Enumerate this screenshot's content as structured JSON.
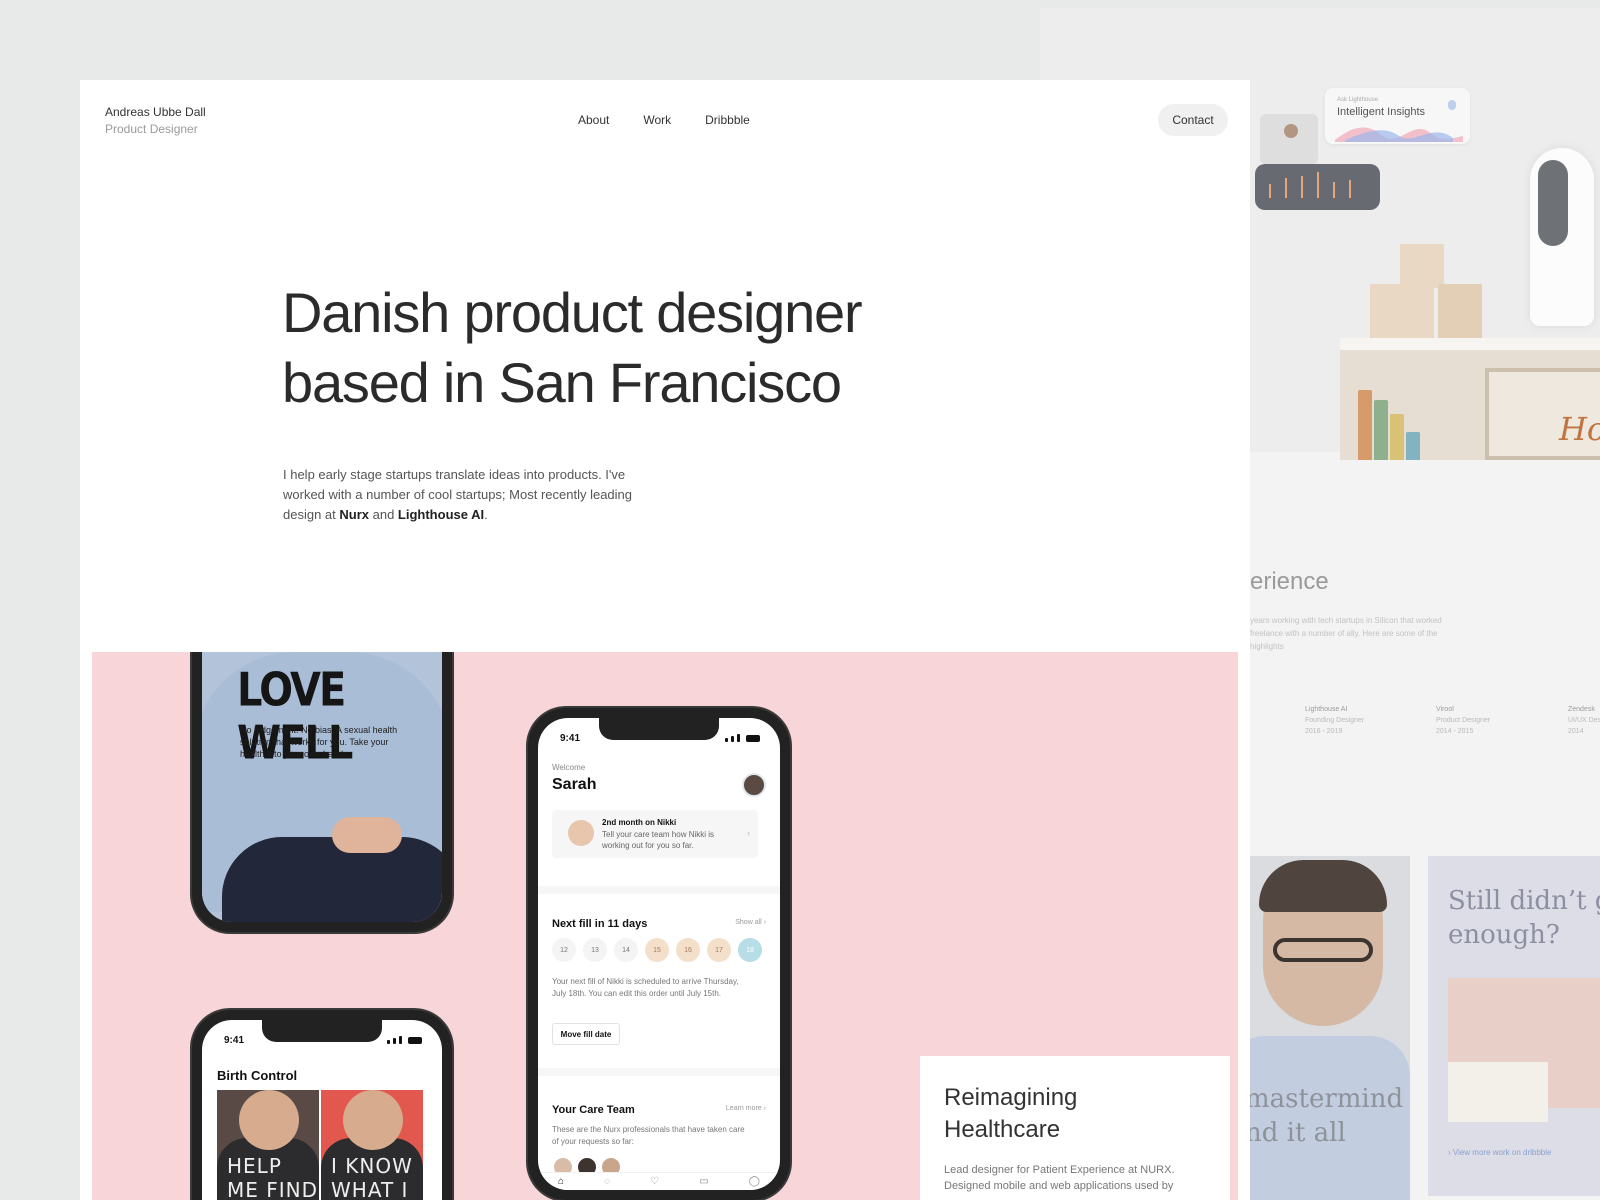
{
  "header": {
    "name": "Andreas Ubbe Dall",
    "role": "Product Designer",
    "nav": [
      "About",
      "Work",
      "Dribbble"
    ],
    "contact_label": "Contact"
  },
  "hero": {
    "title_line1": "Danish product designer",
    "title_line2": "based in San Francisco",
    "text_pre": "I help early stage startups translate ideas into products. I've worked with a number of cool startups; Most recently leading design at ",
    "brand1": "Nurx",
    "and": " and ",
    "brand2": "Lighthouse AI",
    "period": "."
  },
  "case": {
    "phone1": {
      "headline": "LOVE WELL",
      "subtext": "No judgement. No bias. A sexual health solution that works for you. Take your health into your own hands."
    },
    "phone2": {
      "time": "9:41",
      "title": "Birth Control",
      "image1_text": "HELP ME FIND",
      "image2_text": "I KNOW WHAT I"
    },
    "phone3": {
      "time": "9:41",
      "welcome": "Welcome",
      "user": "Sarah",
      "card_title": "2nd month on Nikki",
      "card_text": "Tell your care team how Nikki is working out for you so far.",
      "fill_title": "Next fill in 11 days",
      "show_all": "Show all",
      "days": [
        "12",
        "13",
        "14",
        "15",
        "16",
        "17",
        "18"
      ],
      "fill_text": "Your next fill of Nikki is scheduled to arrive Thursday, July 18th. You can edit this order until July 15th.",
      "move_button": "Move fill date",
      "care_title": "Your Care Team",
      "learn_more": "Learn more",
      "care_text": "These are the Nurx professionals that have taken care of your requests so far:",
      "tabs": [
        "home-icon",
        "chat-icon",
        "heart-icon",
        "calendar-icon",
        "profile-icon"
      ]
    },
    "card": {
      "title": "Reimagining Healthcare",
      "text": "Lead designer for Patient Experience at NURX. Designed mobile and web applications used by"
    },
    "colors": {
      "pink_bg": "#f8d5d8",
      "peach_day": "#f4dfca",
      "active_day": "#b7dde6"
    }
  },
  "background_page": {
    "insights_small": "Ask Lighthouse",
    "insights_title": "Intelligent Insights",
    "frame_text": "Hor",
    "experience_title": "erience",
    "experience_text": "years working with tech startups in Silicon that worked freelance with a number of ally. Here are some of the highlights",
    "jobs": [
      {
        "company": "Lighthouse AI",
        "role": "Founding Designer",
        "years": "2016 - 2019"
      },
      {
        "company": "Virool",
        "role": "Product Designer",
        "years": "2014 - 2015"
      },
      {
        "company": "Zendesk",
        "role": "UI/UX Designer",
        "years": "2014"
      }
    ],
    "mastermind_text": "mastermind nd it all",
    "still_text": "Still didn’t g enough?",
    "more_link": "View more work on dribbble"
  }
}
